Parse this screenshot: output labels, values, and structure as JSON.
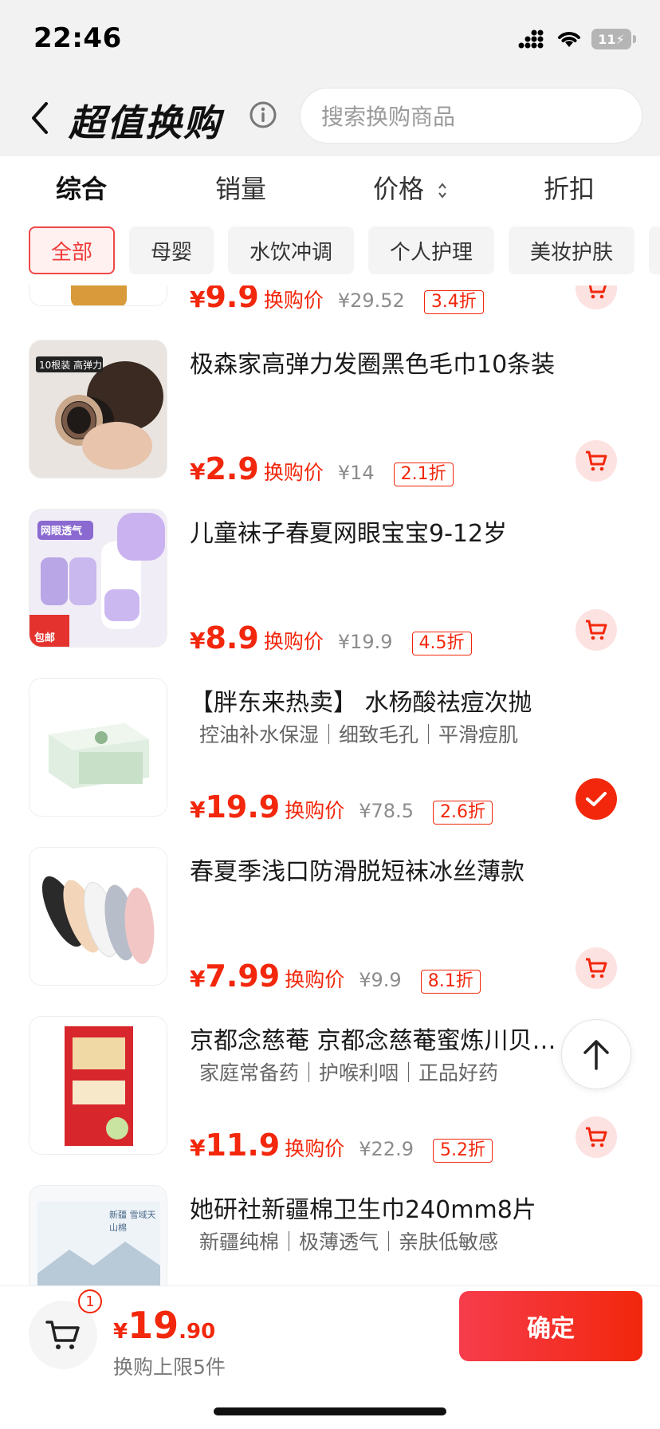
{
  "status_bar": {
    "time": "22:46",
    "battery": "11"
  },
  "header": {
    "title": "超值换购",
    "search_placeholder": "搜索换购商品"
  },
  "sort_tabs": [
    {
      "label": "综合"
    },
    {
      "label": "销量"
    },
    {
      "label": "价格"
    },
    {
      "label": "折扣"
    }
  ],
  "categories": [
    {
      "label": "全部"
    },
    {
      "label": "母婴"
    },
    {
      "label": "水饮冲调"
    },
    {
      "label": "个人护理"
    },
    {
      "label": "美妆护肤"
    }
  ],
  "price_suffix": "换购价",
  "products": [
    {
      "name": "",
      "tags": "",
      "yen": "¥",
      "price": "9.9",
      "original": "¥29.52",
      "discount": "3.4折",
      "selected": false
    },
    {
      "name": "极森家高弹力发圈黑色毛巾10条装",
      "tags": "",
      "yen": "¥",
      "price": "2.9",
      "original": "¥14",
      "discount": "2.1折",
      "selected": false,
      "image_text": "10根装 高弹力"
    },
    {
      "name": "儿童袜子春夏网眼宝宝9-12岁",
      "tags": "",
      "yen": "¥",
      "price": "8.9",
      "original": "¥19.9",
      "discount": "4.5折",
      "selected": false,
      "image_text": "网眼透气",
      "image_badge": "包邮"
    },
    {
      "name": "【胖东来热卖】 水杨酸祛痘次抛",
      "tags": "控油补水保湿｜细致毛孔｜平滑痘肌",
      "yen": "¥",
      "price": "19.9",
      "original": "¥78.5",
      "discount": "2.6折",
      "selected": true
    },
    {
      "name": "春夏季浅口防滑脱短袜冰丝薄款",
      "tags": "",
      "yen": "¥",
      "price": "7.99",
      "original": "¥9.9",
      "discount": "8.1折",
      "selected": false
    },
    {
      "name": "京都念慈菴 京都念慈菴蜜炼川贝枇杷膏",
      "tags": "家庭常备药｜护喉利咽｜正品好药",
      "yen": "¥",
      "price": "11.9",
      "original": "¥22.9",
      "discount": "5.2折",
      "selected": false
    },
    {
      "name": "她研社新疆棉卫生巾240mm8片",
      "tags": "新疆纯棉｜极薄透气｜亲肤低敏感",
      "yen": "¥",
      "price": "",
      "original": "",
      "discount": "",
      "selected": false,
      "image_text": "新疆 雪域天山棉"
    }
  ],
  "bottom_bar": {
    "cart_count": "1",
    "yen": "¥",
    "total_int": "19",
    "total_dec": ".90",
    "limit_text": "换购上限5件",
    "confirm_label": "确定"
  },
  "colors": {
    "accent": "#f2270c",
    "chip_active_border": "#f04848",
    "cart_bg": "#fde2e2"
  },
  "icons": [
    "signal-icon",
    "wifi-icon",
    "battery-icon",
    "back-arrow-icon",
    "info-icon",
    "sort-arrows-icon",
    "cart-icon",
    "check-icon",
    "arrow-up-icon"
  ]
}
